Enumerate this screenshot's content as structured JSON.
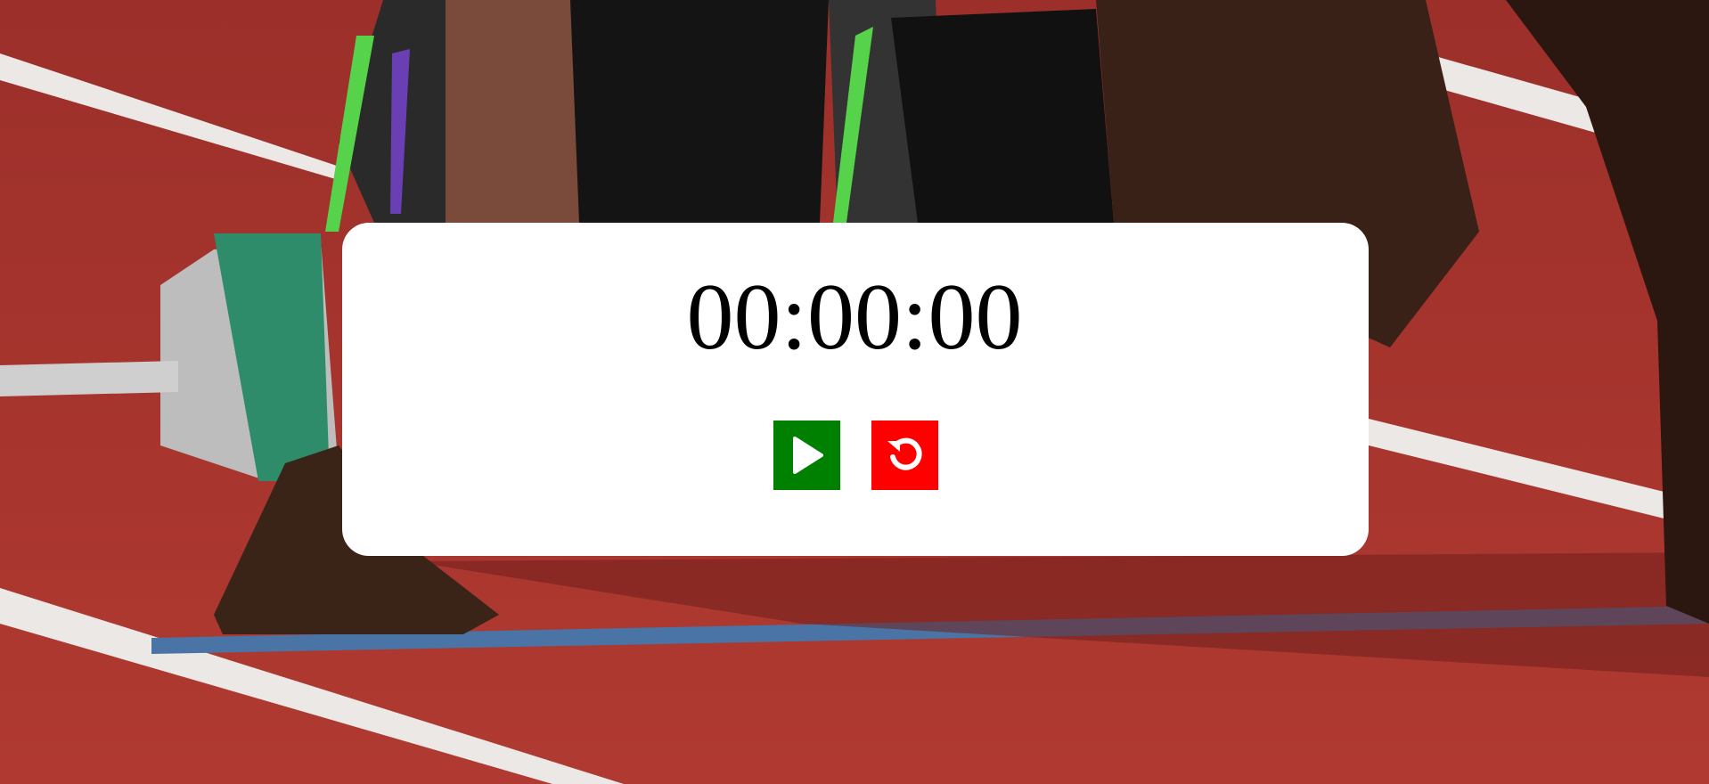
{
  "timer": {
    "display": "00:00:00"
  },
  "controls": {
    "start": {
      "icon": "play-icon",
      "color": "#008000"
    },
    "reset": {
      "icon": "reset-icon",
      "color": "#ff0000"
    }
  },
  "background": {
    "description_icon": "running-track-photo",
    "track_color": "#a8342e",
    "lane_line_color": "#f2f2f2",
    "blue_line_color": "#4a76a8"
  }
}
